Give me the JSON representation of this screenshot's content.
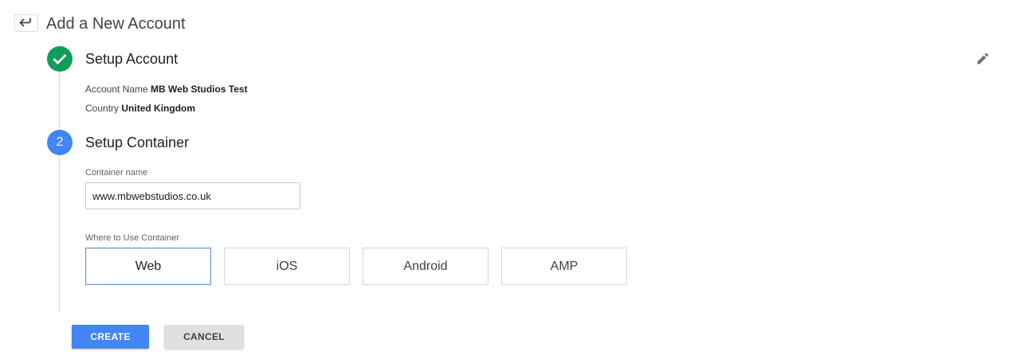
{
  "header": {
    "title": "Add a New Account",
    "back_icon": "back-arrow-icon"
  },
  "step1": {
    "title": "Setup Account",
    "status_icon": "checkmark-icon",
    "edit_icon": "pencil-icon",
    "account_name_label": "Account Name",
    "account_name_value": "MB Web Studios Test",
    "country_label": "Country",
    "country_value": "United Kingdom"
  },
  "step2": {
    "number": "2",
    "title": "Setup Container",
    "container_name_label": "Container name",
    "container_name_value": "www.mbwebstudios.co.uk",
    "where_label": "Where to Use Container",
    "platforms": [
      "Web",
      "iOS",
      "Android",
      "AMP"
    ],
    "selected_platform": "Web"
  },
  "actions": {
    "create_label": "CREATE",
    "cancel_label": "CANCEL"
  },
  "colors": {
    "success_green": "#0f9d58",
    "primary_blue": "#4285f4",
    "selected_border": "#6b94d6"
  }
}
